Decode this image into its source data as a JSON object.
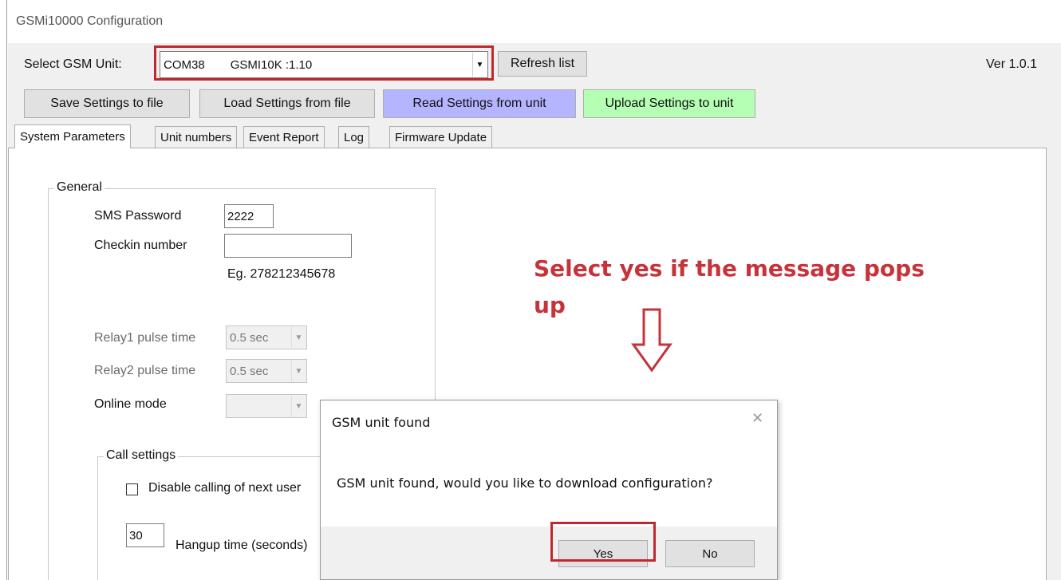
{
  "window": {
    "title": "GSMi10000 Configuration",
    "version": "Ver 1.0.1"
  },
  "unit_selector": {
    "label": "Select GSM Unit:",
    "port": "COM38",
    "device": "GSMI10K :1.10",
    "refresh_label": "Refresh list"
  },
  "toolbar": {
    "save_label": "Save Settings to file",
    "load_label": "Load Settings from file",
    "read_label": "Read Settings from unit",
    "upload_label": "Upload Settings to unit",
    "read_color": "#b4b4ff",
    "upload_color": "#b4ffb4"
  },
  "tabs": [
    {
      "label": "System Parameters"
    },
    {
      "label": "Unit numbers"
    },
    {
      "label": "Event Report"
    },
    {
      "label": "Log"
    },
    {
      "label": "Firmware Update"
    }
  ],
  "general": {
    "title": "General",
    "sms_password_label": "SMS Password",
    "sms_password_value": "2222",
    "checkin_label": "Checkin number",
    "checkin_value": "",
    "checkin_hint": "Eg. 278212345678",
    "relay1_label": "Relay1 pulse time",
    "relay1_value": "0.5 sec",
    "relay2_label": "Relay2 pulse time",
    "relay2_value": "0.5 sec",
    "online_label": "Online mode",
    "online_value": ""
  },
  "call_settings": {
    "title": "Call settings",
    "disable_calling_label": "Disable calling of next user",
    "disable_calling_checked": false,
    "hangup_value": "30",
    "hangup_label": "Hangup time (seconds)"
  },
  "annotation": {
    "text_line1": "Select yes if the message pops",
    "text_line2": "up",
    "color": "#c8323a"
  },
  "dialog": {
    "title": "GSM unit found",
    "message": "GSM unit found, would you like to download configuration?",
    "yes_label": "Yes",
    "no_label": "No",
    "close_glyph": "✕"
  }
}
